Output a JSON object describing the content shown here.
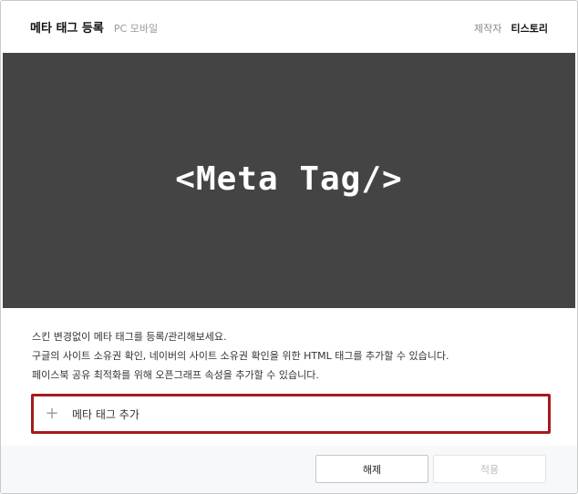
{
  "header": {
    "title": "메타 태그 등록",
    "subtitle": "PC 모바일",
    "author_label": "제작자",
    "author_name": "티스토리"
  },
  "banner": {
    "text": "<Meta Tag/>",
    "background": "#444444"
  },
  "description": [
    "스킨 변경없이 메타 태그를 등록/관리해보세요.",
    "구글의 사이트 소유권 확인, 네이버의 사이트 소유권 확인을 위한 HTML 태그를 추가할 수 있습니다.",
    "페이스북 공유 최적화를 위해 오픈그래프 속성을 추가할 수 있습니다."
  ],
  "add_tag": {
    "icon": "plus-icon",
    "label": "메타 태그 추가",
    "highlight_color": "#a61a1a"
  },
  "footer": {
    "cancel_label": "해제",
    "apply_label": "적용"
  }
}
